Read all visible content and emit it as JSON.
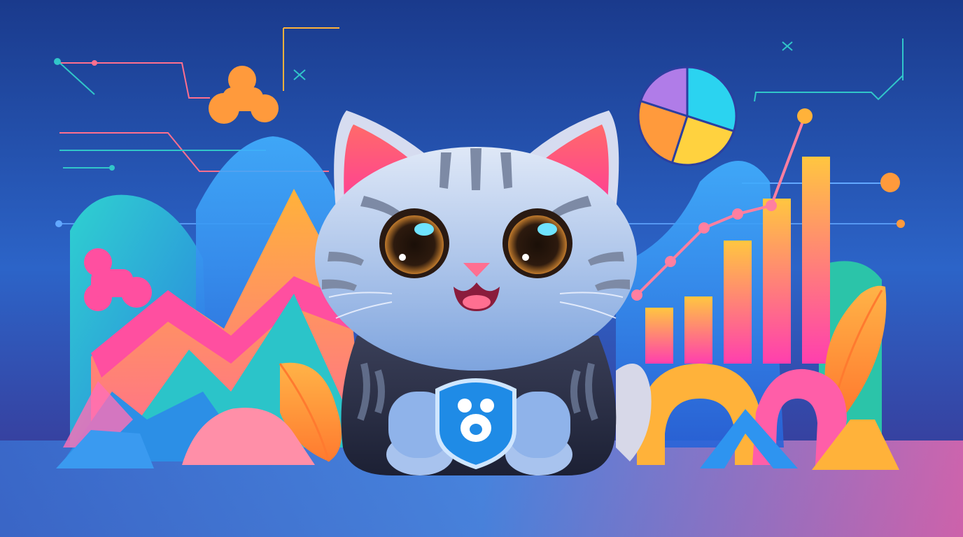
{
  "scene": {
    "subject": "cat-mascot",
    "badge_icon": "bear-paw-icon",
    "decorations": [
      "bar-chart",
      "pie-chart",
      "line-graph",
      "mountains",
      "leaves",
      "geometric-shapes"
    ]
  },
  "colors": {
    "bg_top": "#1a3a8c",
    "bg_mid": "#2c64c8",
    "bg_bottom": "#3c2e8a",
    "floor": "#4a8fe8",
    "cat_fur": "#c9dbf3",
    "cat_stripe": "#7d8aa5",
    "ear_inner": "#ff5a8a",
    "eye": "#2a1a12",
    "badge": "#1f8be6",
    "accent_orange": "#ff9a3c",
    "accent_pink": "#ff4fa0",
    "accent_yellow": "#ffd23f",
    "accent_teal": "#31c6c9",
    "accent_purple": "#b07ce8",
    "accent_cyan": "#2bd3f0"
  },
  "chart_data": {
    "type": "bar",
    "decorative": true,
    "values": [
      2,
      2.4,
      4.4,
      5.9,
      7.4
    ],
    "pie_slices": [
      30,
      25,
      25,
      20
    ],
    "line_points": [
      1.2,
      2.4,
      3.6,
      4.1,
      4.4,
      7.6
    ]
  }
}
